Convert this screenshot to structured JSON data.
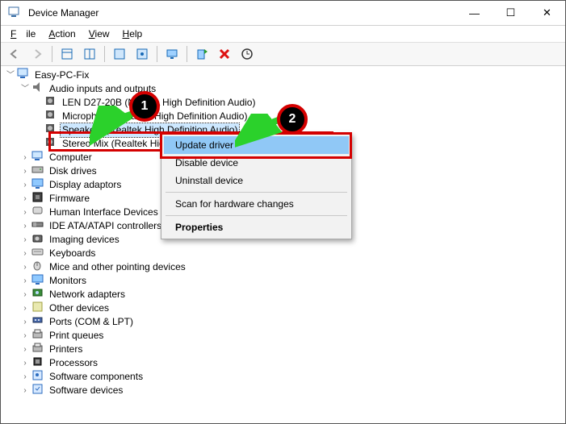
{
  "window": {
    "title": "Device Manager"
  },
  "menu": {
    "file": "File",
    "action": "Action",
    "view": "View",
    "help": "Help"
  },
  "sys": {
    "min": "—",
    "max": "☐",
    "close": "✕"
  },
  "tree": {
    "root": "Easy-PC-Fix",
    "audio": {
      "label": "Audio inputs and outputs",
      "items": [
        "LEN D27-20B (NVIDIA High Definition Audio)",
        "Microphone (Realtek High Definition Audio)",
        "Speakers (Realtek High Definition Audio)",
        "Stereo Mix (Realtek High Definition Audio)"
      ]
    },
    "cats": [
      "Computer",
      "Disk drives",
      "Display adaptors",
      "Firmware",
      "Human Interface Devices",
      "IDE ATA/ATAPI controllers",
      "Imaging devices",
      "Keyboards",
      "Mice and other pointing devices",
      "Monitors",
      "Network adapters",
      "Other devices",
      "Ports (COM & LPT)",
      "Print queues",
      "Printers",
      "Processors",
      "Software components",
      "Software devices"
    ]
  },
  "ctx": {
    "update": "Update driver",
    "disable": "Disable device",
    "uninstall": "Uninstall device",
    "scan": "Scan for hardware changes",
    "props": "Properties"
  },
  "badges": {
    "one": "1",
    "two": "2"
  }
}
